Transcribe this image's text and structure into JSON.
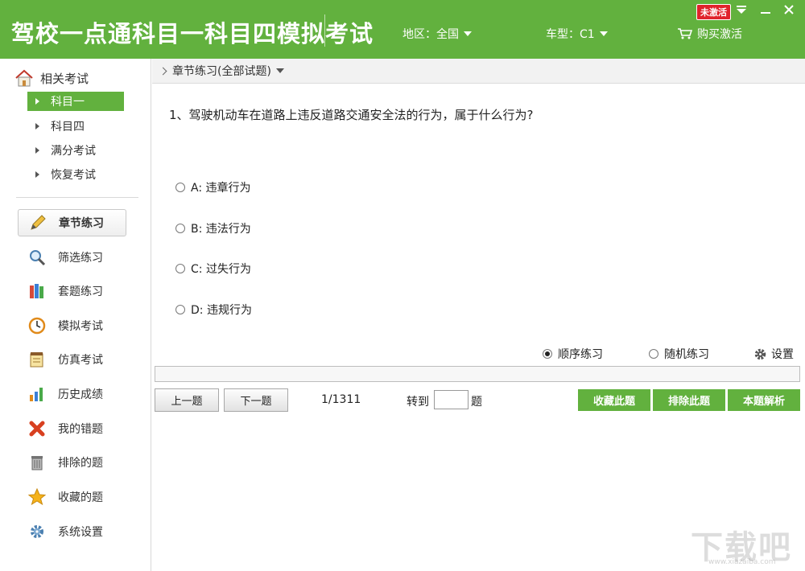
{
  "header": {
    "app_title": "驾校一点通科目一科目四模拟考试",
    "region_label": "地区：全国",
    "car_type_label": "车型：C1",
    "buy_label": "购买激活",
    "status_badge": "未激活",
    "brand_color": "#62b13e"
  },
  "sidebar": {
    "related_label": "相关考试",
    "sub_items": [
      {
        "label": "科目一",
        "active": true
      },
      {
        "label": "科目四",
        "active": false
      },
      {
        "label": "满分考试",
        "active": false
      },
      {
        "label": "恢复考试",
        "active": false
      }
    ],
    "nav_items": [
      {
        "label": "章节练习",
        "icon": "pencil-icon",
        "active": true
      },
      {
        "label": "筛选练习",
        "icon": "magnifier-icon",
        "active": false
      },
      {
        "label": "套题练习",
        "icon": "books-icon",
        "active": false
      },
      {
        "label": "模拟考试",
        "icon": "clock-icon",
        "active": false
      },
      {
        "label": "仿真考试",
        "icon": "notepad-icon",
        "active": false
      },
      {
        "label": "历史成绩",
        "icon": "bar-chart-icon",
        "active": false
      },
      {
        "label": "我的错题",
        "icon": "red-x-icon",
        "active": false
      },
      {
        "label": "排除的题",
        "icon": "trash-icon",
        "active": false
      },
      {
        "label": "收藏的题",
        "icon": "star-icon",
        "active": false
      },
      {
        "label": "系统设置",
        "icon": "gear-icon",
        "active": false
      }
    ]
  },
  "main": {
    "breadcrumb": "章节练习(全部试题)",
    "question": "1、驾驶机动车在道路上违反道路交通安全法的行为，属于什么行为?",
    "options": [
      {
        "label": "A: 违章行为"
      },
      {
        "label": "B: 违法行为"
      },
      {
        "label": "C: 过失行为"
      },
      {
        "label": "D: 违规行为"
      }
    ],
    "modes": {
      "sequential": "顺序练习",
      "random": "随机练习",
      "selected": "sequential"
    },
    "settings_label": "设置",
    "progress": 0.0,
    "prev_label": "上一题",
    "next_label": "下一题",
    "counter": "1/1311",
    "goto_label": "转到",
    "goto_value": "",
    "goto_suffix": "题",
    "favorite_label": "收藏此题",
    "exclude_label": "排除此题",
    "explain_label": "本题解析"
  },
  "watermark": {
    "text": "下载吧",
    "sub": "www.xiazaiba.com"
  }
}
